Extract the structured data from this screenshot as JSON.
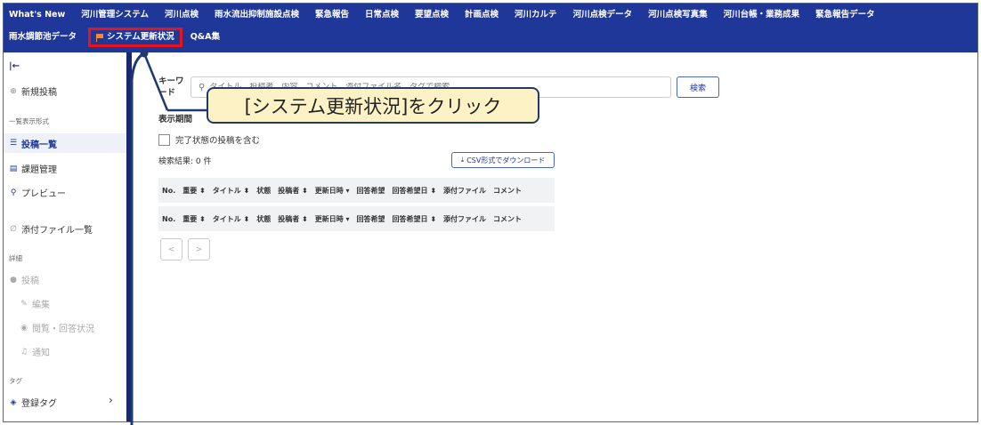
{
  "nav": {
    "row1": [
      "What's New",
      "河川管理システム",
      "河川点検",
      "雨水流出抑制施設点検",
      "緊急報告",
      "日常点検",
      "要望点検",
      "計画点検",
      "河川カルテ",
      "河川点検データ",
      "河川点検写真集",
      "河川台帳・業務成果",
      "緊急報告データ"
    ],
    "row2_first": "雨水調節池データ",
    "row2_active": "システム更新状況",
    "row2_last": "Q&A集",
    "active_outline": "#e8141b",
    "bg": "#20379a"
  },
  "sidebar": {
    "new_post": "新規投稿",
    "section_list": "一覧表示形式",
    "post_list": "投稿一覧",
    "issue_mgmt": "課題管理",
    "preview": "プレビュー",
    "attachments": "添付ファイル一覧",
    "section_detail": "詳細",
    "post": "投稿",
    "edit": "編集",
    "browse_status": "閲覧・回答状況",
    "notify": "通知",
    "section_tag": "タグ",
    "registered_tags": "登録タグ"
  },
  "main": {
    "keyword_label": "キーワード",
    "search_placeholder": "タイトル、投稿者、内容、コメント、添付ファイル名、タグで検索",
    "search_button": "検索",
    "period_label": "表示期間",
    "include_done": "完了状態の投稿を含む",
    "result": "検索結果: 0 件",
    "csv_button": "CSV形式でダウンロード",
    "columns": [
      "No.",
      "重要 ⬍",
      "タイトル ⬍",
      "状態",
      "投稿者 ⬍",
      "更新日時 ▾",
      "回答希望",
      "回答希望日 ⬍",
      "添付ファイル",
      "コメント"
    ],
    "prev": "<",
    "next": ">"
  },
  "callout": {
    "text": "[システム更新状況]をクリック"
  }
}
